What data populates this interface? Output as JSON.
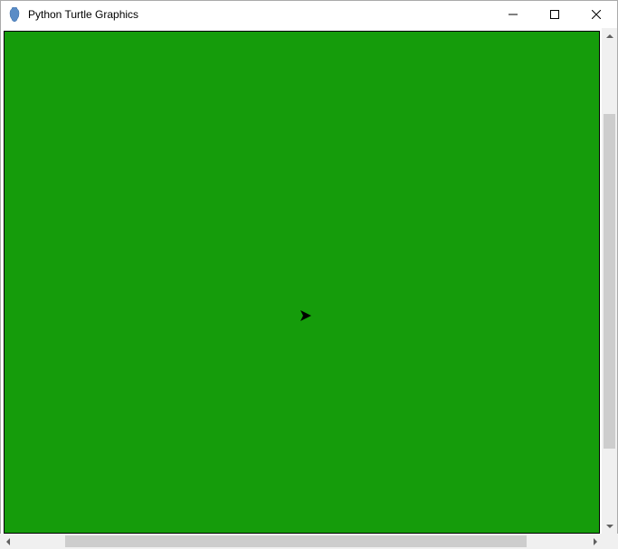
{
  "window": {
    "title": "Python Turtle Graphics"
  },
  "canvas": {
    "background_color": "#159c0b",
    "turtle_color": "#000000"
  }
}
